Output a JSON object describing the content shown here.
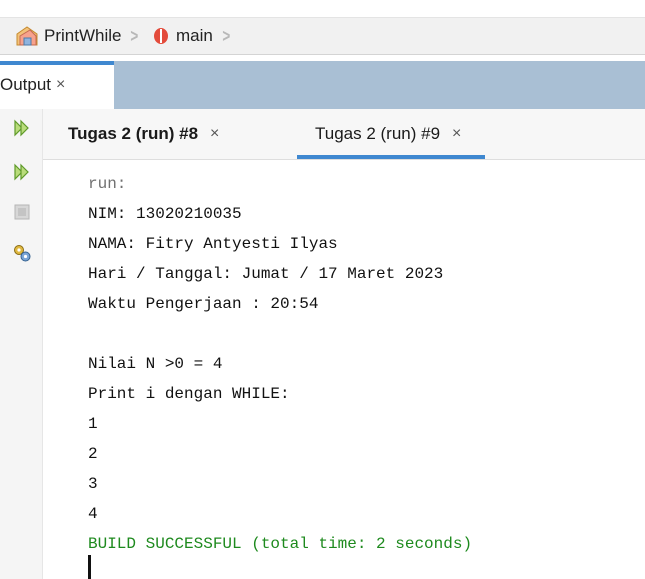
{
  "breadcrumb": {
    "project": "PrintWhile",
    "method": "main"
  },
  "output": {
    "tab_label": "Output",
    "close_glyph": "×"
  },
  "run_tabs": [
    {
      "label": "Tugas 2 (run) #8",
      "close": "×",
      "bold": true,
      "active": false
    },
    {
      "label": "Tugas 2 (run) #9",
      "close": "×",
      "bold": false,
      "active": true
    }
  ],
  "gutter_icons": [
    "rerun-icon",
    "rerun-with-options-icon",
    "stop-icon",
    "output-settings-icon"
  ],
  "console": {
    "lines": [
      "run:",
      "NIM: 13020210035",
      "NAMA: Fitry Antyesti Ilyas",
      "Hari / Tanggal: Jumat / 17 Maret 2023",
      "Waktu Pengerjaan : 20:54",
      "",
      "Nilai N >0 = 4",
      "Print i dengan WHILE:",
      "1",
      "2",
      "3",
      "4",
      "BUILD SUCCESSFUL (total time: 2 seconds)"
    ]
  },
  "colors": {
    "accent": "#3f88d0",
    "success": "#1e8a1e",
    "panel_header": "#a9bfd4"
  }
}
